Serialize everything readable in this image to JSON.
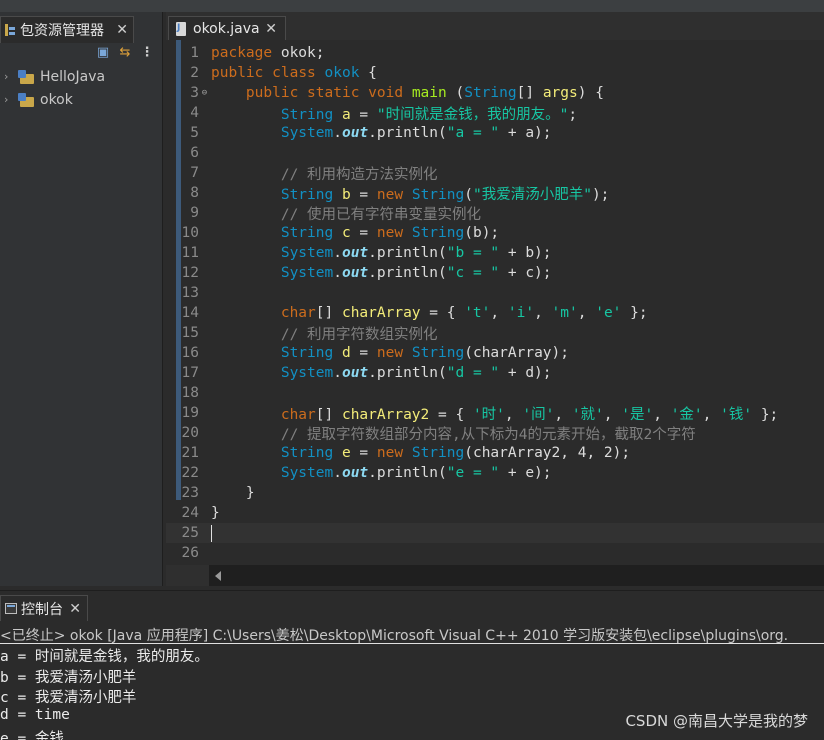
{
  "package_explorer": {
    "tab_label": "包资源管理器",
    "tab_close": "✕",
    "toolbar": {
      "collapse_icon": "▣",
      "link_icon": "⇆",
      "more_icon": "⋮"
    },
    "tree": [
      {
        "chevron": "›",
        "label": "HelloJava"
      },
      {
        "chevron": "›",
        "label": "okok"
      }
    ]
  },
  "editor": {
    "tab_label": "okok.java",
    "tab_close": "✕",
    "lines": [
      {
        "n": "1"
      },
      {
        "n": "2"
      },
      {
        "n": "3"
      },
      {
        "n": "4"
      },
      {
        "n": "5"
      },
      {
        "n": "6"
      },
      {
        "n": "7"
      },
      {
        "n": "8"
      },
      {
        "n": "9"
      },
      {
        "n": "10"
      },
      {
        "n": "11"
      },
      {
        "n": "12"
      },
      {
        "n": "13"
      },
      {
        "n": "14"
      },
      {
        "n": "15"
      },
      {
        "n": "16"
      },
      {
        "n": "17"
      },
      {
        "n": "18"
      },
      {
        "n": "19"
      },
      {
        "n": "20"
      },
      {
        "n": "21"
      },
      {
        "n": "22"
      },
      {
        "n": "23"
      },
      {
        "n": "24"
      },
      {
        "n": "25"
      },
      {
        "n": "26"
      }
    ],
    "code": {
      "l1": {
        "kw": "package",
        "rest": " okok;"
      },
      "l2": {
        "kw1": "public",
        "kw2": "class",
        "name": "okok",
        "brace": " {"
      },
      "l3": {
        "kw1": "public",
        "kw2": "static",
        "kw3": "void",
        "fn": "main",
        "p1": " (",
        "ty": "String",
        "p2": "[] ",
        "var": "args",
        "p3": ") {",
        "marker": "⊖"
      },
      "l4": {
        "ty": "String",
        "var": "a",
        "eq": " = ",
        "str": "\"时间就是金钱，我的朋友。\"",
        "end": ";"
      },
      "l5": {
        "ty": "System",
        "dot": ".",
        "fld": "out",
        "call": ".println(",
        "str": "\"a = \"",
        "rest": " + a);"
      },
      "l7": {
        "cm": "// 利用构造方法实例化"
      },
      "l8": {
        "ty": "String",
        "var": "b",
        "eq": " = ",
        "kw": "new",
        "sp": " ",
        "ty2": "String",
        "op": "(",
        "str": "\"我爱清汤小肥羊\"",
        "end": ");"
      },
      "l9": {
        "cm": "// 使用已有字符串变量实例化"
      },
      "l10": {
        "ty": "String",
        "var": "c",
        "eq": " = ",
        "kw": "new",
        "sp": " ",
        "ty2": "String",
        "rest": "(b);"
      },
      "l11": {
        "ty": "System",
        "dot": ".",
        "fld": "out",
        "call": ".println(",
        "str": "\"b = \"",
        "rest": " + b);"
      },
      "l12": {
        "ty": "System",
        "dot": ".",
        "fld": "out",
        "call": ".println(",
        "str": "\"c = \"",
        "rest": " + c);"
      },
      "l14": {
        "kw": "char",
        "p1": "[] ",
        "var": "charArray",
        "p2": " = { ",
        "c1": "'t'",
        "c2": "'i'",
        "c3": "'m'",
        "c4": "'e'",
        "comma": ", ",
        "end": " };"
      },
      "l15": {
        "cm": "// 利用字符数组实例化"
      },
      "l16": {
        "ty": "String",
        "var": "d",
        "eq": " = ",
        "kw": "new",
        "sp": " ",
        "ty2": "String",
        "rest": "(charArray);"
      },
      "l17": {
        "ty": "System",
        "dot": ".",
        "fld": "out",
        "call": ".println(",
        "str": "\"d = \"",
        "rest": " + d);"
      },
      "l19": {
        "kw": "char",
        "p1": "[] ",
        "var": "charArray2",
        "p2": " = { ",
        "c1": "'时'",
        "c2": "'间'",
        "c3": "'就'",
        "c4": "'是'",
        "c5": "'金'",
        "c6": "'钱'",
        "comma": ", ",
        "end": " };"
      },
      "l20": {
        "cm": "// 提取字符数组部分内容,从下标为4的元素开始，截取2个字符"
      },
      "l21": {
        "ty": "String",
        "var": "e",
        "eq": " = ",
        "kw": "new",
        "sp": " ",
        "ty2": "String",
        "rest": "(charArray2, 4, 2);"
      },
      "l22": {
        "ty": "System",
        "dot": ".",
        "fld": "out",
        "call": ".println(",
        "str": "\"e = \"",
        "rest": " + e);"
      },
      "l23": {
        "rest": "}"
      },
      "l24": {
        "rest": "}"
      }
    }
  },
  "console": {
    "tab_label": "控制台",
    "tab_close": "✕",
    "header": "<已终止> okok [Java 应用程序] C:\\Users\\姜松\\Desktop\\Microsoft Visual C++ 2010 学习版安装包\\eclipse\\plugins\\org.",
    "output": [
      "a = 时间就是金钱，我的朋友。",
      "b = 我爱清汤小肥羊",
      "c = 我爱清汤小肥羊",
      "d = time",
      "e = 金钱"
    ]
  },
  "watermark": "CSDN @南昌大学是我的梦"
}
